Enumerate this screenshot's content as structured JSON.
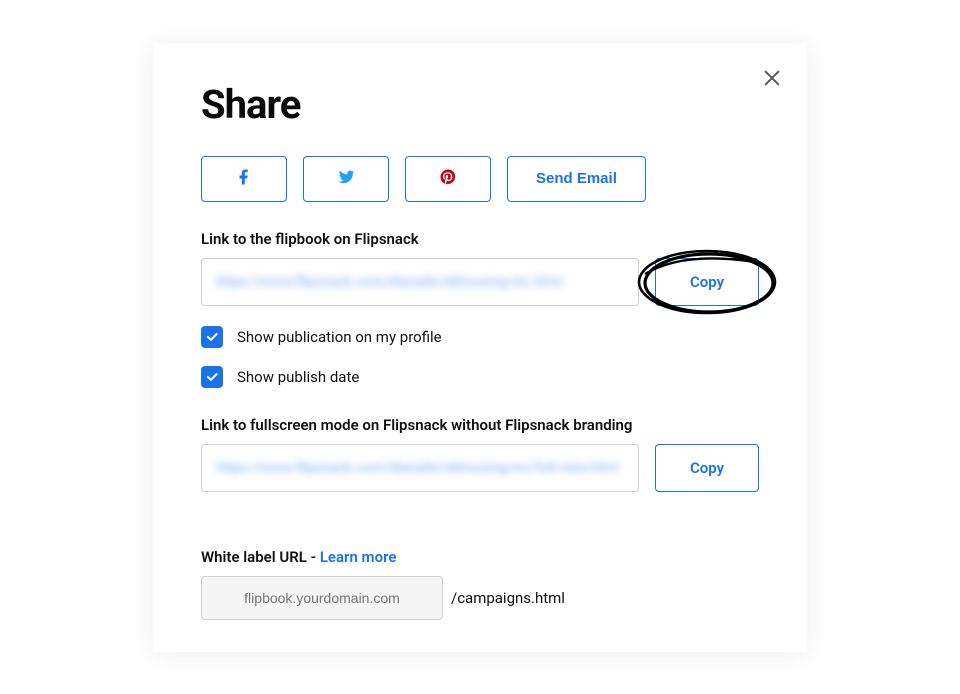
{
  "modal": {
    "title": "Share",
    "send_email_label": "Send Email"
  },
  "link1": {
    "label": "Link to the flipbook on Flipsnack",
    "value": "https://www.flipsnack.com/dianaile/okhousing-inc.html",
    "copy_label": "Copy"
  },
  "checkboxes": {
    "profile": {
      "label": "Show publication on my profile",
      "checked": true
    },
    "date": {
      "label": "Show publish date",
      "checked": true
    }
  },
  "link2": {
    "label": "Link to fullscreen mode on Flipsnack without Flipsnack branding",
    "value": "https://www.flipsnack.com/dianaile/okhousing-inc/full-view.html",
    "copy_label": "Copy"
  },
  "whitelabel": {
    "prefix": "White label URL - ",
    "learn_more": "Learn more",
    "placeholder": "flipbook.yourdomain.com",
    "path": "/campaigns.html"
  }
}
